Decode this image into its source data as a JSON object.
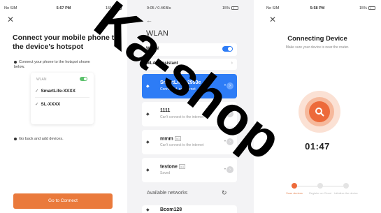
{
  "left_screen": {
    "status": {
      "carrier": "No SIM",
      "time": "5:57 PM",
      "battery": "15%"
    },
    "title": "Connect your mobile phone to the device's hotspot",
    "step1": "Connect your phone to the hotspot shown below.",
    "wifi_card": {
      "header": "WLAN",
      "networks": [
        "SmartLife-XXXX",
        "SL-XXXX"
      ]
    },
    "step2": "Go back and add devices.",
    "button": "Go to Connect"
  },
  "middle_screen": {
    "status": {
      "left": "9:05 / 0.4KB/s",
      "right": "15%"
    },
    "title": "WLAN",
    "wlan_label": "WLAN",
    "assistant_label": "WLAN assistant",
    "networks": [
      {
        "name": "SmartLife-b2953e",
        "sub": "Connected, no internet",
        "tag": ""
      },
      {
        "name": "1111",
        "sub": "Can't connect to the internet",
        "tag": ""
      },
      {
        "name": "mmm",
        "sub": "Can't connect to the internet",
        "tag": "5G"
      },
      {
        "name": "testone",
        "sub": "Saved",
        "tag": "5G"
      }
    ],
    "available_label": "Available networks",
    "bottom_network": "Bcom128"
  },
  "right_screen": {
    "status": {
      "carrier": "No SIM",
      "time": "5:58 PM",
      "battery": "15%"
    },
    "title": "Connecting Device",
    "subtitle": "Make sure your device is near the router.",
    "timer": "01:47",
    "steps": [
      "Scan devices",
      "Register on Cloud",
      "Initialize the device"
    ]
  },
  "watermark": "Ka-shop",
  "colors": {
    "accent_orange": "#ea7a3c",
    "accent_blue": "#2d7cf6",
    "toggle_green": "#5cc16c"
  }
}
